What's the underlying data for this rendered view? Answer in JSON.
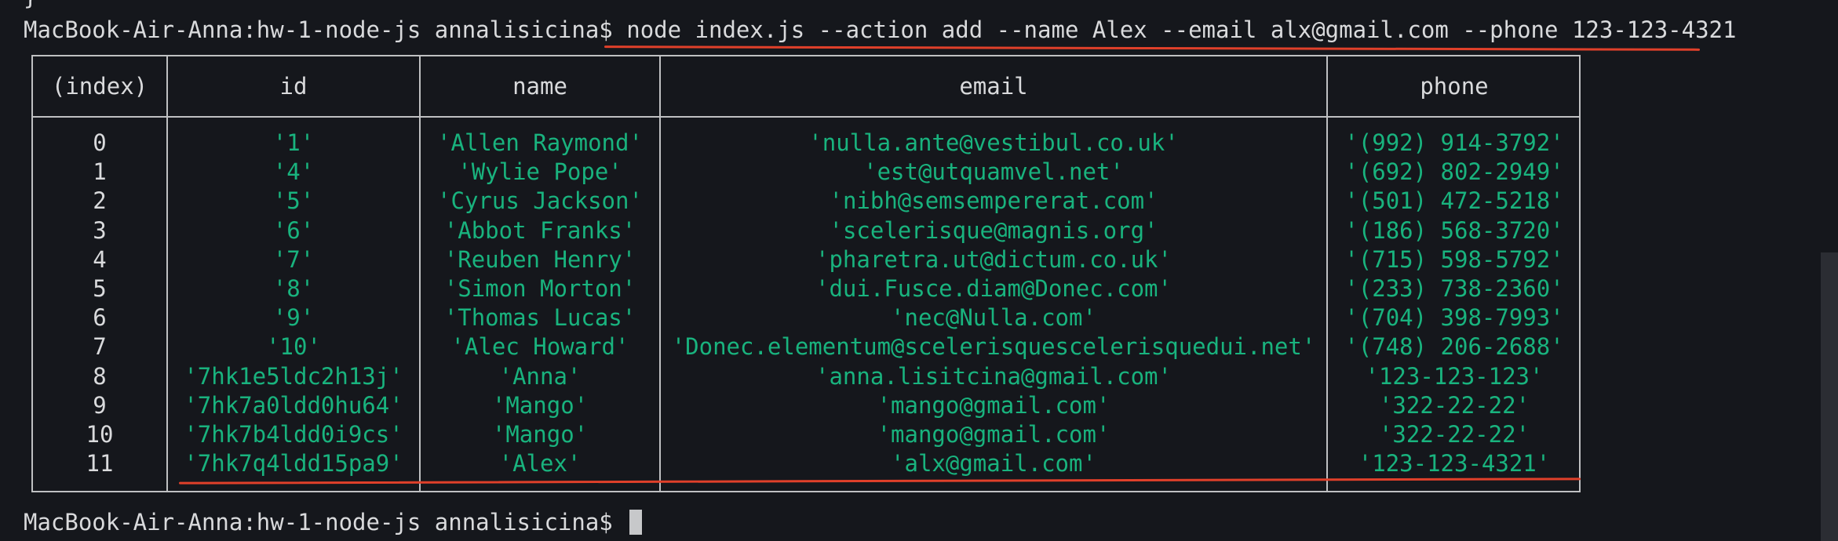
{
  "terminal": {
    "brace": "}",
    "prompt": "MacBook-Air-Anna:hw-1-node-js annalisicina$",
    "command": "node index.js --action add --name Alex --email alx@gmail.com --phone 123-123-4321",
    "final_prompt": "MacBook-Air-Anna:hw-1-node-js annalisicina$"
  },
  "table": {
    "headers": [
      "(index)",
      "id",
      "name",
      "email",
      "phone"
    ],
    "rows": [
      {
        "index": "0",
        "id": "'1'",
        "name": "'Allen Raymond'",
        "email": "'nulla.ante@vestibul.co.uk'",
        "phone": "'(992) 914-3792'"
      },
      {
        "index": "1",
        "id": "'4'",
        "name": "'Wylie Pope'",
        "email": "'est@utquamvel.net'",
        "phone": "'(692) 802-2949'"
      },
      {
        "index": "2",
        "id": "'5'",
        "name": "'Cyrus Jackson'",
        "email": "'nibh@semsempererat.com'",
        "phone": "'(501) 472-5218'"
      },
      {
        "index": "3",
        "id": "'6'",
        "name": "'Abbot Franks'",
        "email": "'scelerisque@magnis.org'",
        "phone": "'(186) 568-3720'"
      },
      {
        "index": "4",
        "id": "'7'",
        "name": "'Reuben Henry'",
        "email": "'pharetra.ut@dictum.co.uk'",
        "phone": "'(715) 598-5792'"
      },
      {
        "index": "5",
        "id": "'8'",
        "name": "'Simon Morton'",
        "email": "'dui.Fusce.diam@Donec.com'",
        "phone": "'(233) 738-2360'"
      },
      {
        "index": "6",
        "id": "'9'",
        "name": "'Thomas Lucas'",
        "email": "'nec@Nulla.com'",
        "phone": "'(704) 398-7993'"
      },
      {
        "index": "7",
        "id": "'10'",
        "name": "'Alec Howard'",
        "email": "'Donec.elementum@scelerisquescelerisquedui.net'",
        "phone": "'(748) 206-2688'"
      },
      {
        "index": "8",
        "id": "'7hk1e5ldc2h13j'",
        "name": "'Anna'",
        "email": "'anna.lisitcina@gmail.com'",
        "phone": "'123-123-123'"
      },
      {
        "index": "9",
        "id": "'7hk7a0ldd0hu64'",
        "name": "'Mango'",
        "email": "'mango@gmail.com'",
        "phone": "'322-22-22'"
      },
      {
        "index": "10",
        "id": "'7hk7b4ldd0i9cs'",
        "name": "'Mango'",
        "email": "'mango@gmail.com'",
        "phone": "'322-22-22'"
      },
      {
        "index": "11",
        "id": "'7hk7q4ldd15pa9'",
        "name": "'Alex'",
        "email": "'alx@gmail.com'",
        "phone": "'123-123-4321'"
      }
    ]
  },
  "colors": {
    "background": "#15171c",
    "text": "#d9dadc",
    "value_green": "#19b37e",
    "annotation_red": "#e0402a"
  }
}
